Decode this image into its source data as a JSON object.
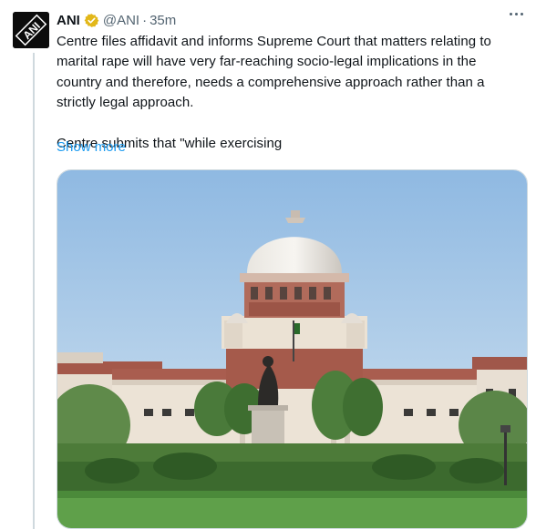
{
  "tweet": {
    "author_name": "ANI",
    "handle": "@ANI",
    "separator": "·",
    "time": "35m",
    "text_paragraph_1": "Centre files affidavit and informs Supreme Court that matters relating to\nmarital rape will have very far-reaching socio-legal implications in the\ncountry and therefore, needs a comprehensive approach rather than a\nstrictly legal approach.",
    "text_paragraph_2": "Centre submits that \"while exercising",
    "show_more_label": "Show more",
    "avatar_text": "ANI"
  },
  "icons": {
    "verified": "verified-badge-icon",
    "more": "more-options-icon"
  },
  "colors": {
    "link": "#1d9bf0",
    "verified_gold": "#e2b719",
    "secondary_text": "#536471",
    "border": "#cfd9de"
  }
}
